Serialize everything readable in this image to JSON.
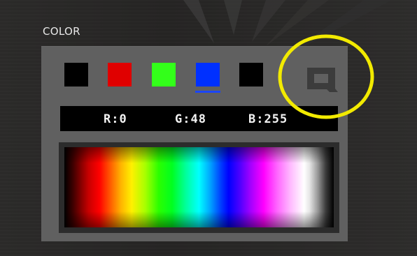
{
  "section": {
    "label": "COLOR"
  },
  "swatches": [
    {
      "name": "black",
      "color": "#000000"
    },
    {
      "name": "red",
      "color": "#e00000"
    },
    {
      "name": "green",
      "color": "#33ff1a"
    },
    {
      "name": "blue",
      "color": "#0030ff",
      "selected": true
    },
    {
      "name": "black",
      "color": "#000000"
    }
  ],
  "readout": {
    "r": "R:0",
    "g": "G:48",
    "b": "B:255"
  },
  "icons": {
    "custom_color": "q-logo-icon"
  },
  "annotation": {
    "color": "#f2ea00"
  },
  "colors": {
    "panel": "#606060",
    "background": "#242322",
    "selection_underline": "#1a45ff"
  }
}
